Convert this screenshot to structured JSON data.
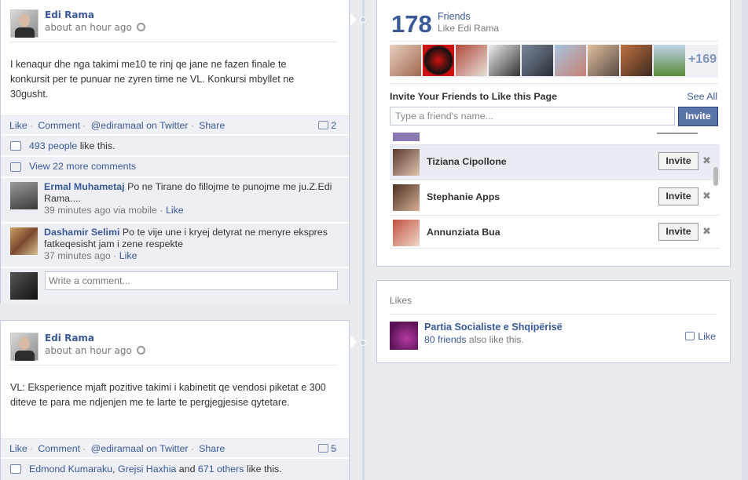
{
  "posts": [
    {
      "author": "Edi Rama",
      "time": "about an hour ago",
      "text": "I kenaqur dhe nga takimi me10 te rinj qe jane ne fazen finale te konkursit per te punuar ne zyren time ne VL. Konkursi mbyllet ne 30gusht.",
      "actions": {
        "like": "Like",
        "comment": "Comment",
        "twitter": "@ediramaal on Twitter",
        "share": "Share"
      },
      "comment_count": "2",
      "likes_prefix": "493 people",
      "likes_suffix": " like this.",
      "view_more": "View 22 more comments",
      "comments": [
        {
          "author": "Ermal Muhametaj",
          "text": "Po ne Tirane do fillojme te punojme me ju.Z.Edi Rama....",
          "time": "39 minutes ago via mobile",
          "like": "Like"
        },
        {
          "author": "Dashamir Selimi",
          "text": "Po te vije une i kryej detyrat ne menyre ekspres fatkeqesisht jam i zene respekte",
          "time": "37 minutes ago",
          "like": "Like"
        }
      ],
      "write_placeholder": "Write a comment..."
    },
    {
      "author": "Edi Rama",
      "time": "about an hour ago",
      "text": "VL: Eksperience mjaft pozitive takimi i kabinetit qe vendosi piketat e 300 diteve te para me ndjenjen me te larte te pergjegjesise qytetare.",
      "actions": {
        "like": "Like",
        "comment": "Comment",
        "twitter": "@ediramaal on Twitter",
        "share": "Share"
      },
      "comment_count": "5",
      "likes_names": [
        "Edmond Kumaraku",
        "Grejsi Haxhia"
      ],
      "likes_and": " and ",
      "likes_others": "671 others",
      "likes_suffix": " like this."
    }
  ],
  "friends": {
    "count": "178",
    "title": "Friends",
    "subtitle": "Like Edi Rama",
    "more": "+169",
    "invite_heading": "Invite Your Friends to Like this Page",
    "see_all": "See All",
    "input_placeholder": "Type a friend's name...",
    "invite_label": "Invite",
    "list": [
      {
        "name": "Tiziana Cipollone",
        "button": "Invite"
      },
      {
        "name": "Stephanie Apps",
        "button": "Invite"
      },
      {
        "name": "Annunziata Bua",
        "button": "Invite"
      }
    ]
  },
  "likes_box": {
    "label": "Likes",
    "page_name": "Partia Socialiste e Shqipërisë",
    "friends_count": "80 friends",
    "friends_suffix": " also like this.",
    "like_label": "Like"
  },
  "colors": {
    "link": "#3b5998",
    "button": "#5b74a8",
    "background": "#e9ebee"
  }
}
